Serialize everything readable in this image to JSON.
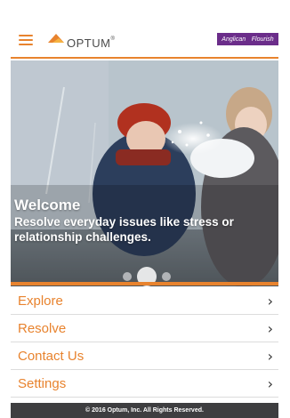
{
  "header": {
    "logo_text": "OPTUM",
    "logo_mark": "®",
    "partner_name_1": "Anglican",
    "partner_name_2": "Flourish"
  },
  "hero": {
    "title": "Welcome",
    "tagline": "Resolve everyday issues like stress or relationship challenges.",
    "carousel_pages": 3,
    "active_page": 2
  },
  "menu": {
    "items": [
      {
        "label": "Explore",
        "chevron": "›"
      },
      {
        "label": "Resolve",
        "chevron": "›"
      },
      {
        "label": "Contact Us",
        "chevron": "›"
      },
      {
        "label": "Settings",
        "chevron": "›"
      }
    ]
  },
  "footer": {
    "copyright": "© 2016 Optum, Inc. All Rights Reserved."
  },
  "colors": {
    "accent": "#e8832e",
    "partner": "#6b2d8a",
    "footer_bg": "#3e3e40"
  },
  "icons": [
    "hamburger-icon",
    "optum-logo-icon",
    "chevron-right-icon"
  ]
}
